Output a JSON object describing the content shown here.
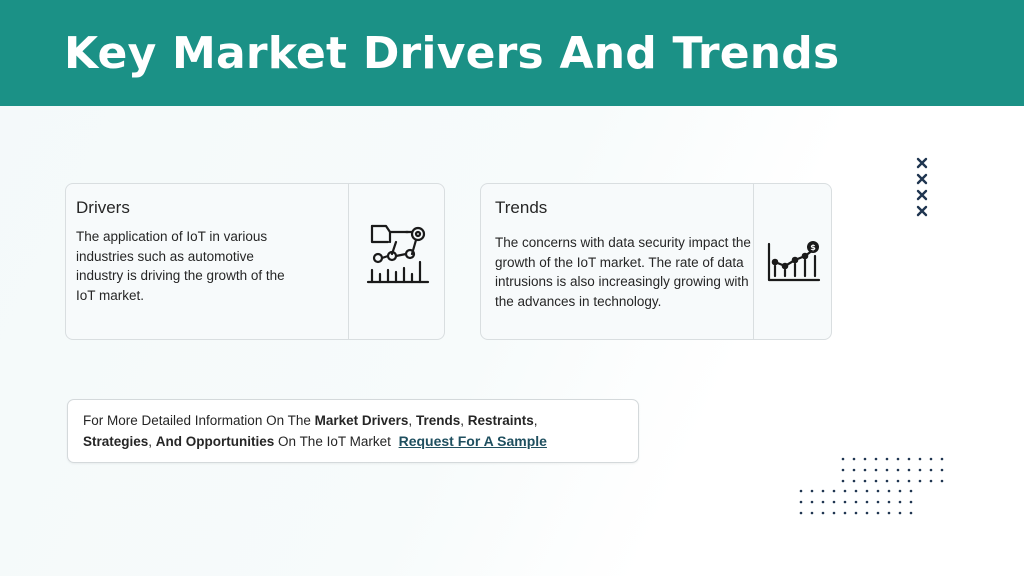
{
  "header": {
    "title": "Key Market Drivers And Trends"
  },
  "drivers": {
    "title": "Drivers",
    "body": "The application of IoT in various industries such as automotive industry is driving the growth of the IoT market.",
    "icon": "robotic-arm-chart-icon"
  },
  "trends": {
    "title": "Trends",
    "body": "The concerns with data security impact the growth of the IoT market. The rate of data intrusions is also increasingly growing with the advances in technology.",
    "icon": "growth-chart-dollar-icon"
  },
  "info": {
    "p1": "For More Detailed Information On The ",
    "b1": "Market Drivers",
    "s1": ", ",
    "b2": "Trends",
    "s2": ", ",
    "b3": "Restraints",
    "s3": ", ",
    "b4": "Strategies",
    "s4": ", ",
    "b5": "And Opportunities",
    "p2": " On The IoT Market ",
    "link": "Request For A Sample"
  },
  "colors": {
    "header": "#1b9186",
    "accent_dark": "#1f3550",
    "link": "#1f4f5f"
  }
}
